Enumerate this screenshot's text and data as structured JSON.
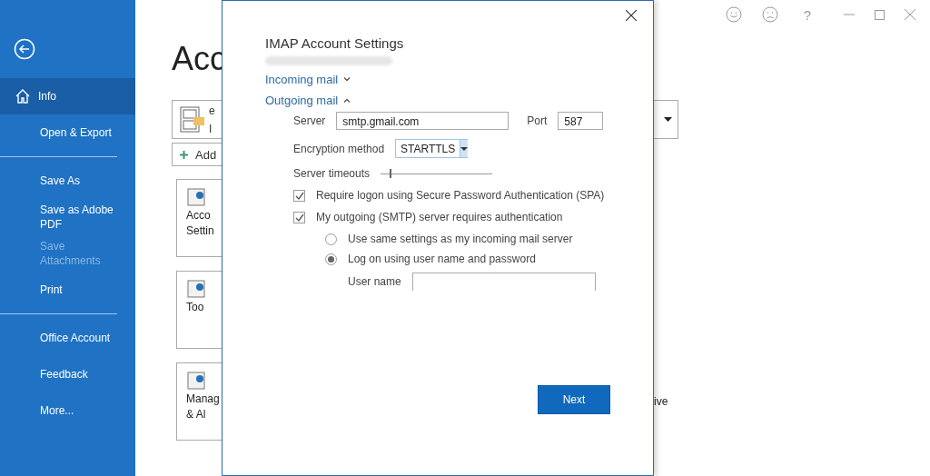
{
  "sidebar": {
    "groups": [
      {
        "items": [
          {
            "label": "Info",
            "selected": true,
            "disabled": false
          },
          {
            "label": "Open & Export",
            "selected": false,
            "disabled": false
          }
        ]
      },
      {
        "items": [
          {
            "label": "Save As",
            "selected": false,
            "disabled": false
          },
          {
            "label": "Save as Adobe PDF",
            "selected": false,
            "disabled": false
          },
          {
            "label": "Save Attachments",
            "selected": false,
            "disabled": true
          },
          {
            "label": "Print",
            "selected": false,
            "disabled": false
          }
        ]
      },
      {
        "items": [
          {
            "label": "Office Account",
            "selected": false,
            "disabled": false
          },
          {
            "label": "Feedback",
            "selected": false,
            "disabled": false
          },
          {
            "label": "More...",
            "selected": false,
            "disabled": false
          }
        ]
      }
    ]
  },
  "title_bar": {
    "help": "?"
  },
  "background": {
    "title": "Acc",
    "account_lines": [
      "e",
      "I"
    ],
    "add_button": "Add",
    "tiles": [
      {
        "lines": [
          "Acco",
          "Settin"
        ]
      },
      {
        "lines": [
          "Too"
        ]
      },
      {
        "lines": [
          "Manag",
          "& Al"
        ]
      }
    ],
    "side_text": "ive"
  },
  "dialog": {
    "title": "IMAP Account Settings",
    "sections": [
      {
        "label": "Incoming mail",
        "expanded": false
      },
      {
        "label": "Outgoing mail",
        "expanded": true
      }
    ],
    "server": {
      "label": "Server",
      "value": "smtp.gmail.com"
    },
    "port": {
      "label": "Port",
      "value": "587"
    },
    "encryption": {
      "label": "Encryption method",
      "value": "STARTTLS"
    },
    "timeouts": {
      "label": "Server timeouts",
      "level": 0.08
    },
    "checkboxes": [
      {
        "label": "Require logon using Secure Password Authentication (SPA)",
        "checked": true
      },
      {
        "label": "My outgoing (SMTP) server requires authentication",
        "checked": true
      }
    ],
    "radios": [
      {
        "label": "Use same settings as my incoming mail server",
        "selected": false
      },
      {
        "label": "Log on using user name and password",
        "selected": true
      }
    ],
    "username": {
      "label": "User name"
    },
    "next_button": "Next"
  }
}
